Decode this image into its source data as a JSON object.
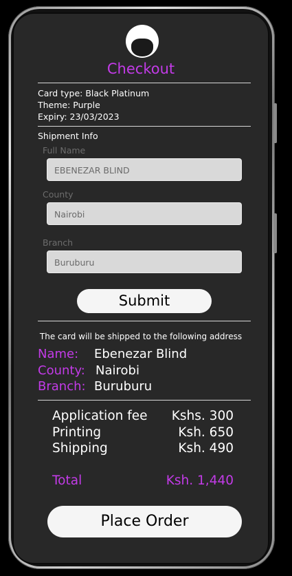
{
  "header": {
    "title": "Checkout"
  },
  "card": {
    "type": "Card type: Black Platinum",
    "theme": "Theme: Purple",
    "expiry": "Expiry: 23/03/2023"
  },
  "shipment": {
    "heading": "Shipment Info",
    "full_name_label": "Full Name",
    "full_name_value": "EBENEZAR BLIND",
    "county_label": "County",
    "county_value": "Nairobi",
    "branch_label": "Branch",
    "branch_value": "Buruburu",
    "submit_label": "Submit"
  },
  "address": {
    "note": "The card will be shipped to the following address",
    "name_label": "Name:",
    "name_value": "Ebenezar Blind",
    "county_label": "County:",
    "county_value": "Nairobi",
    "branch_label": "Branch:",
    "branch_value": "Buruburu"
  },
  "costs": {
    "items": [
      {
        "label": "Application fee",
        "value": "Kshs. 300"
      },
      {
        "label": "Printing",
        "value": "Ksh. 650"
      },
      {
        "label": "Shipping",
        "value": "Ksh. 490"
      }
    ],
    "total_label": "Total",
    "total_value": "Ksh. 1,440"
  },
  "order": {
    "place_order_label": "Place Order"
  },
  "colors": {
    "accent": "#c33be8",
    "screen": "#282828"
  }
}
